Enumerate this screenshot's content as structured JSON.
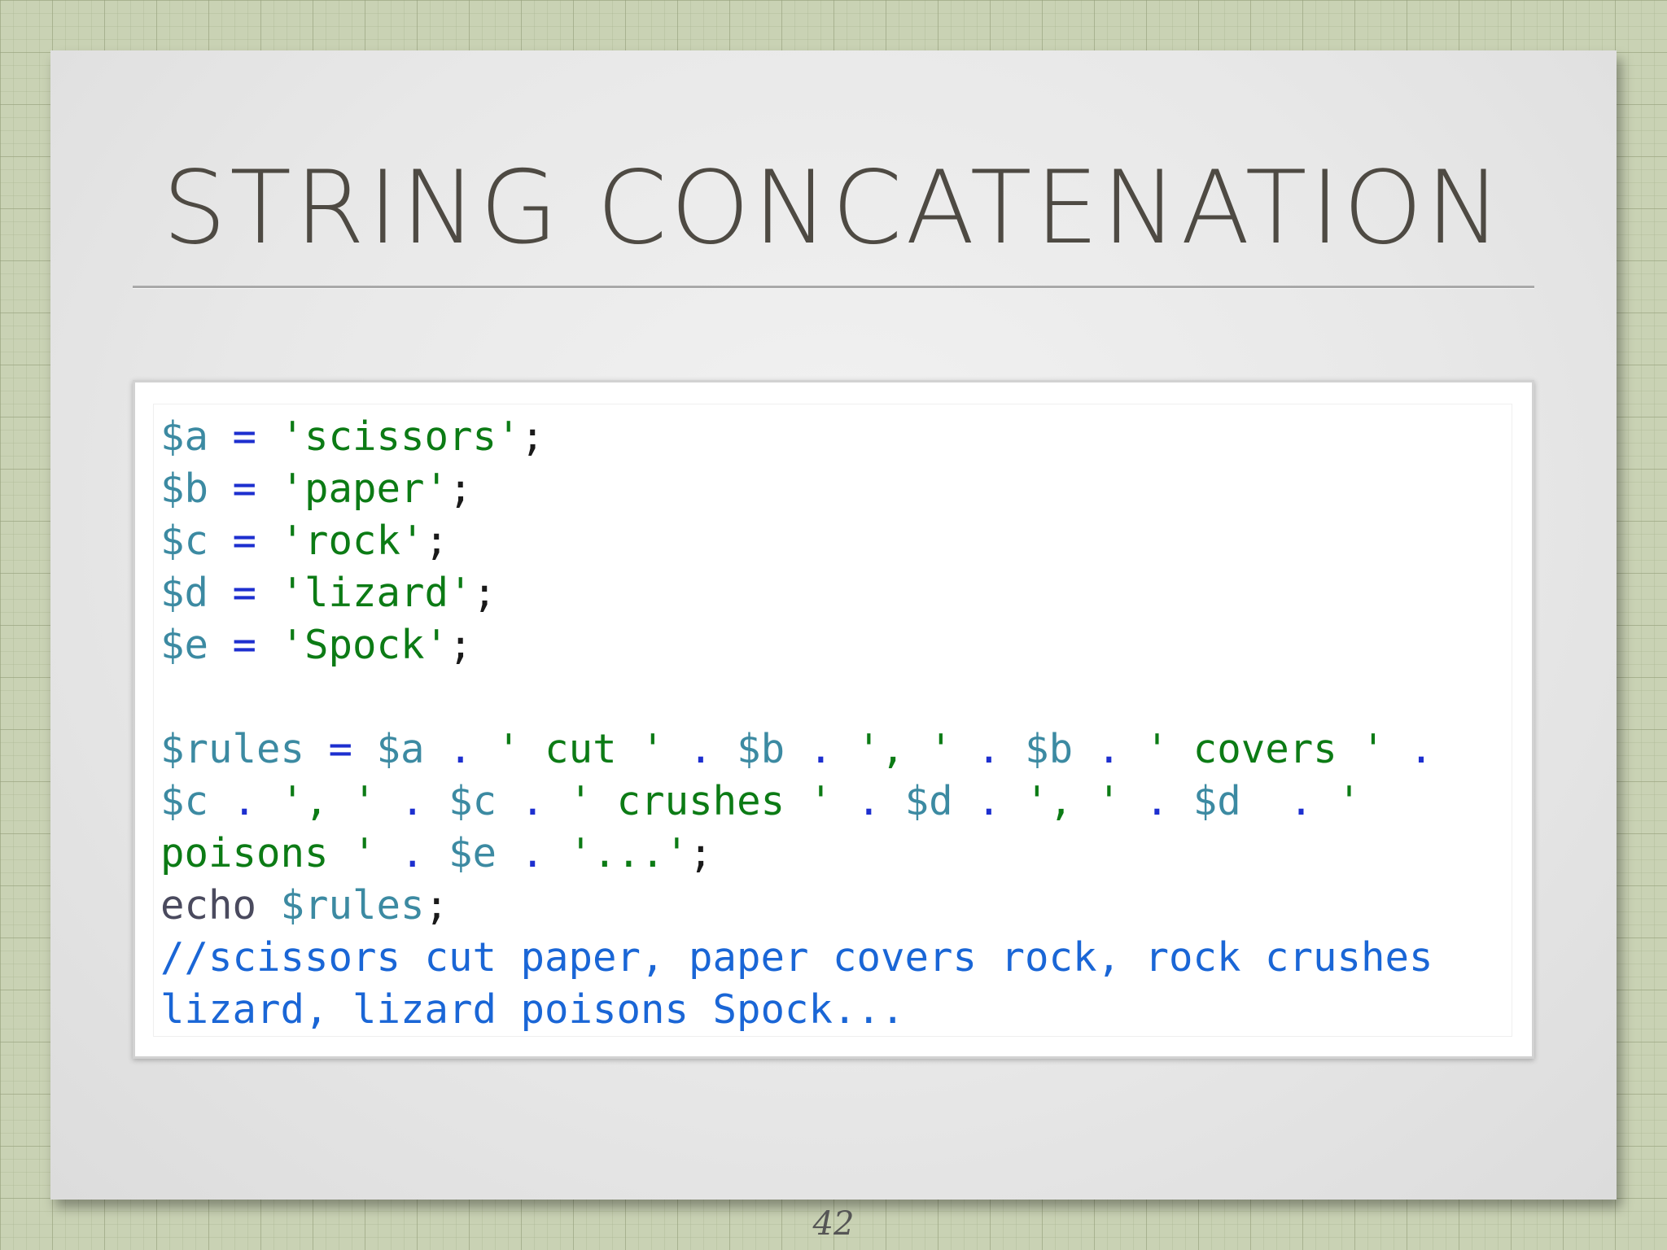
{
  "slide": {
    "title": "STRING CONCATENATION",
    "page_number": "42"
  },
  "code": {
    "lines": [
      {
        "tokens": [
          {
            "type": "var",
            "text": "$a"
          },
          {
            "type": "op",
            "text": " = "
          },
          {
            "type": "str",
            "text": "'scissors'"
          },
          {
            "type": "pun",
            "text": ";"
          }
        ]
      },
      {
        "tokens": [
          {
            "type": "var",
            "text": "$b"
          },
          {
            "type": "op",
            "text": " = "
          },
          {
            "type": "str",
            "text": "'paper'"
          },
          {
            "type": "pun",
            "text": ";"
          }
        ]
      },
      {
        "tokens": [
          {
            "type": "var",
            "text": "$c"
          },
          {
            "type": "op",
            "text": " = "
          },
          {
            "type": "str",
            "text": "'rock'"
          },
          {
            "type": "pun",
            "text": ";"
          }
        ]
      },
      {
        "tokens": [
          {
            "type": "var",
            "text": "$d"
          },
          {
            "type": "op",
            "text": " = "
          },
          {
            "type": "str",
            "text": "'lizard'"
          },
          {
            "type": "pun",
            "text": ";"
          }
        ]
      },
      {
        "tokens": [
          {
            "type": "var",
            "text": "$e"
          },
          {
            "type": "op",
            "text": " = "
          },
          {
            "type": "str",
            "text": "'Spock'"
          },
          {
            "type": "pun",
            "text": ";"
          }
        ]
      },
      {
        "tokens": []
      },
      {
        "tokens": [
          {
            "type": "var",
            "text": "$rules"
          },
          {
            "type": "op",
            "text": " = "
          },
          {
            "type": "var",
            "text": "$a"
          },
          {
            "type": "op",
            "text": " . "
          },
          {
            "type": "str",
            "text": "' cut '"
          },
          {
            "type": "op",
            "text": " . "
          },
          {
            "type": "var",
            "text": "$b"
          },
          {
            "type": "op",
            "text": " . "
          },
          {
            "type": "str",
            "text": "', '"
          },
          {
            "type": "op",
            "text": " . "
          },
          {
            "type": "var",
            "text": "$b"
          },
          {
            "type": "op",
            "text": " . "
          },
          {
            "type": "str",
            "text": "' covers '"
          },
          {
            "type": "op",
            "text": " ."
          }
        ]
      },
      {
        "tokens": [
          {
            "type": "var",
            "text": "$c"
          },
          {
            "type": "op",
            "text": " . "
          },
          {
            "type": "str",
            "text": "', '"
          },
          {
            "type": "op",
            "text": " . "
          },
          {
            "type": "var",
            "text": "$c"
          },
          {
            "type": "op",
            "text": " . "
          },
          {
            "type": "str",
            "text": "' crushes '"
          },
          {
            "type": "op",
            "text": " . "
          },
          {
            "type": "var",
            "text": "$d"
          },
          {
            "type": "op",
            "text": " . "
          },
          {
            "type": "str",
            "text": "', '"
          },
          {
            "type": "op",
            "text": " . "
          },
          {
            "type": "var",
            "text": "$d"
          },
          {
            "type": "op",
            "text": "  . "
          },
          {
            "type": "str",
            "text": "'"
          }
        ]
      },
      {
        "tokens": [
          {
            "type": "str",
            "text": "poisons '"
          },
          {
            "type": "op",
            "text": " . "
          },
          {
            "type": "var",
            "text": "$e"
          },
          {
            "type": "op",
            "text": " . "
          },
          {
            "type": "str",
            "text": "'...'"
          },
          {
            "type": "pun",
            "text": ";"
          }
        ]
      },
      {
        "tokens": [
          {
            "type": "kw",
            "text": "echo "
          },
          {
            "type": "var",
            "text": "$rules"
          },
          {
            "type": "pun",
            "text": ";"
          }
        ]
      },
      {
        "tokens": [
          {
            "type": "cmt",
            "text": "//scissors cut paper, paper covers rock, rock crushes"
          }
        ]
      },
      {
        "tokens": [
          {
            "type": "cmt",
            "text": "lizard, lizard poisons Spock..."
          }
        ]
      }
    ]
  }
}
